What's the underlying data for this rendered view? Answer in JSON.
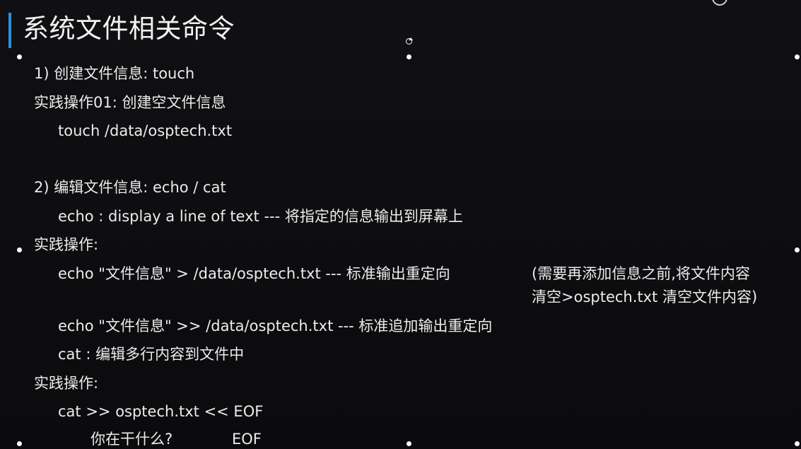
{
  "slide": {
    "title": "系统文件相关命令",
    "lines": [
      "1) 创建文件信息: touch",
      "实践操作01: 创建空文件信息",
      "touch /data/osptech.txt",
      "2) 编辑文件信息: echo  / cat",
      "echo : display a line of text  --- 将指定的信息输出到屏幕上",
      "实践操作:",
      "echo \"文件信息\" >  /data/osptech.txt   --- 标准输出重定向",
      "(需要再添加信息之前,将文件内容",
      "清空>osptech.txt  清空文件内容)",
      "echo \"文件信息\" >> /data/osptech.txt   --- 标准追加输出重定向",
      "cat : 编辑多行内容到文件中",
      "实践操作:",
      "cat >> osptech.txt << EOF",
      "你在干什么?",
      "EOF"
    ]
  },
  "icons": {
    "rotate": "rotate-handle-icon",
    "corner": "record-button-icon"
  },
  "colors": {
    "background": "#0d0d0f",
    "accent": "#2f8fd6",
    "text": "#ececec"
  }
}
